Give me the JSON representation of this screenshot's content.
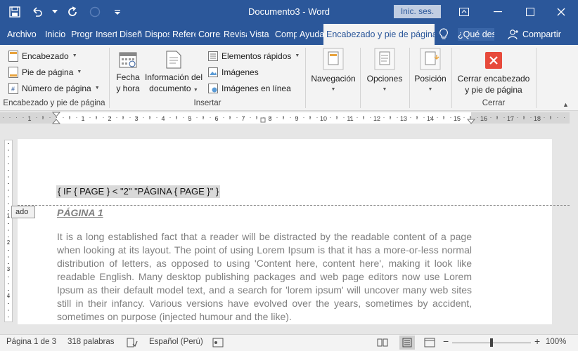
{
  "titlebar": {
    "doc_title": "Documento3 - Word",
    "login_label": "Inic. ses."
  },
  "tabs": [
    {
      "label": "Archivo"
    },
    {
      "label": "Inicio"
    },
    {
      "label": "Programador"
    },
    {
      "label": "Insertar"
    },
    {
      "label": "Diseño"
    },
    {
      "label": "Disposición"
    },
    {
      "label": "Referencias"
    },
    {
      "label": "Correspondencia"
    },
    {
      "label": "Revisar"
    },
    {
      "label": "Vista"
    },
    {
      "label": "Complementos"
    },
    {
      "label": "Ayuda"
    },
    {
      "label": "Encabezado y pie de página"
    }
  ],
  "tell_me": "¿Qué desea hacer?",
  "share_label": "Compartir",
  "ribbon": {
    "group1": {
      "header_btn": "Encabezado",
      "footer_btn": "Pie de página",
      "pagenum_btn": "Número de página",
      "label": "Encabezado y pie de página"
    },
    "insert": {
      "datetime_l1": "Fecha",
      "datetime_l2": "y hora",
      "docinfo_l1": "Información del",
      "docinfo_l2": "documento",
      "quickparts": "Elementos rápidos",
      "images": "Imágenes",
      "online_images": "Imágenes en línea",
      "label": "Insertar"
    },
    "navigation": "Navegación",
    "options": "Opciones",
    "position": "Posición",
    "close": {
      "l1": "Cerrar encabezado",
      "l2": "y pie de página",
      "label": "Cerrar"
    }
  },
  "ruler_numbers": [
    "1",
    "2",
    "3",
    "4",
    "5",
    "6",
    "7",
    "8",
    "9",
    "10",
    "11",
    "12",
    "13",
    "14",
    "15",
    "16",
    "17",
    "18"
  ],
  "document": {
    "field_code": "{ IF {  PAGE } < \"2\" \"PÁGINA { PAGE }\" }",
    "header_tag": "ado",
    "pagina_label": "PÁGINA 1",
    "body": "It is a long established fact that a reader will be distracted by the readable content of a page when looking at its layout. The point of using Lorem Ipsum is that it has a more-or-less normal distribution of letters, as opposed to using 'Content here, content here', making it look like readable English. Many desktop publishing packages and web page editors now use Lorem Ipsum as their default model text, and a search for 'lorem ipsum' will uncover many web sites still in their infancy. Various versions have evolved over the years, sometimes by accident, sometimes on purpose (injected humour and the like)."
  },
  "status": {
    "page": "Página 1 de 3",
    "words": "318 palabras",
    "language": "Español (Perú)",
    "zoom": "100%",
    "zoom_value": 100
  },
  "colors": {
    "accent": "#2b579a",
    "ribbon_bg": "#f3f3f3",
    "close_red": "#e74a3b"
  }
}
